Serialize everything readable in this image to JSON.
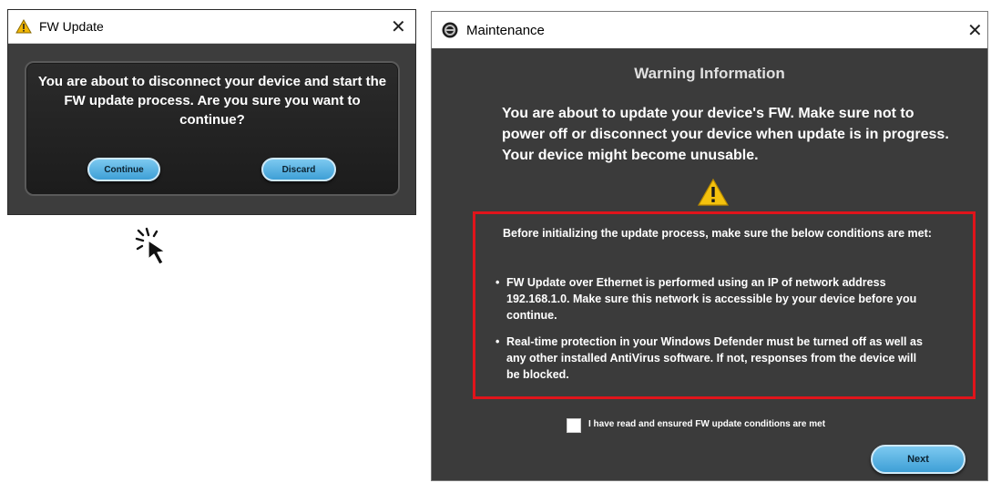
{
  "fw_dialog": {
    "title": "FW Update",
    "message": "You are about to disconnect your device and start the FW update process. Are you sure you want to continue?",
    "continue_label": "Continue",
    "discard_label": "Discard",
    "close_glyph": "✕"
  },
  "maintenance_dialog": {
    "title": "Maintenance",
    "close_glyph": "✕",
    "heading": "Warning Information",
    "warning_text": "You are about to update your device's FW. Make sure not to power off or disconnect your device when update is in progress. Your device might become unusable.",
    "conditions": {
      "intro": "Before initializing the update process, make sure the below conditions are met:",
      "items": [
        "FW Update over Ethernet is performed using an IP of network address 192.168.1.0. Make sure this network is accessible by your device before you continue.",
        "Real-time protection in your Windows Defender must be turned off as well as any other installed AntiVirus software. If not, responses from the device will be blocked."
      ]
    },
    "checkbox_label": "I have read and ensured FW update conditions are met",
    "checkbox_checked": false,
    "next_label": "Next"
  },
  "colors": {
    "highlight_border": "#e0141b",
    "button_blue": "#5fb6e6",
    "dialog_dark": "#3b3b3b"
  },
  "icons": [
    "warning-icon",
    "close-icon",
    "maintenance-logo-icon",
    "click-cursor-icon"
  ]
}
